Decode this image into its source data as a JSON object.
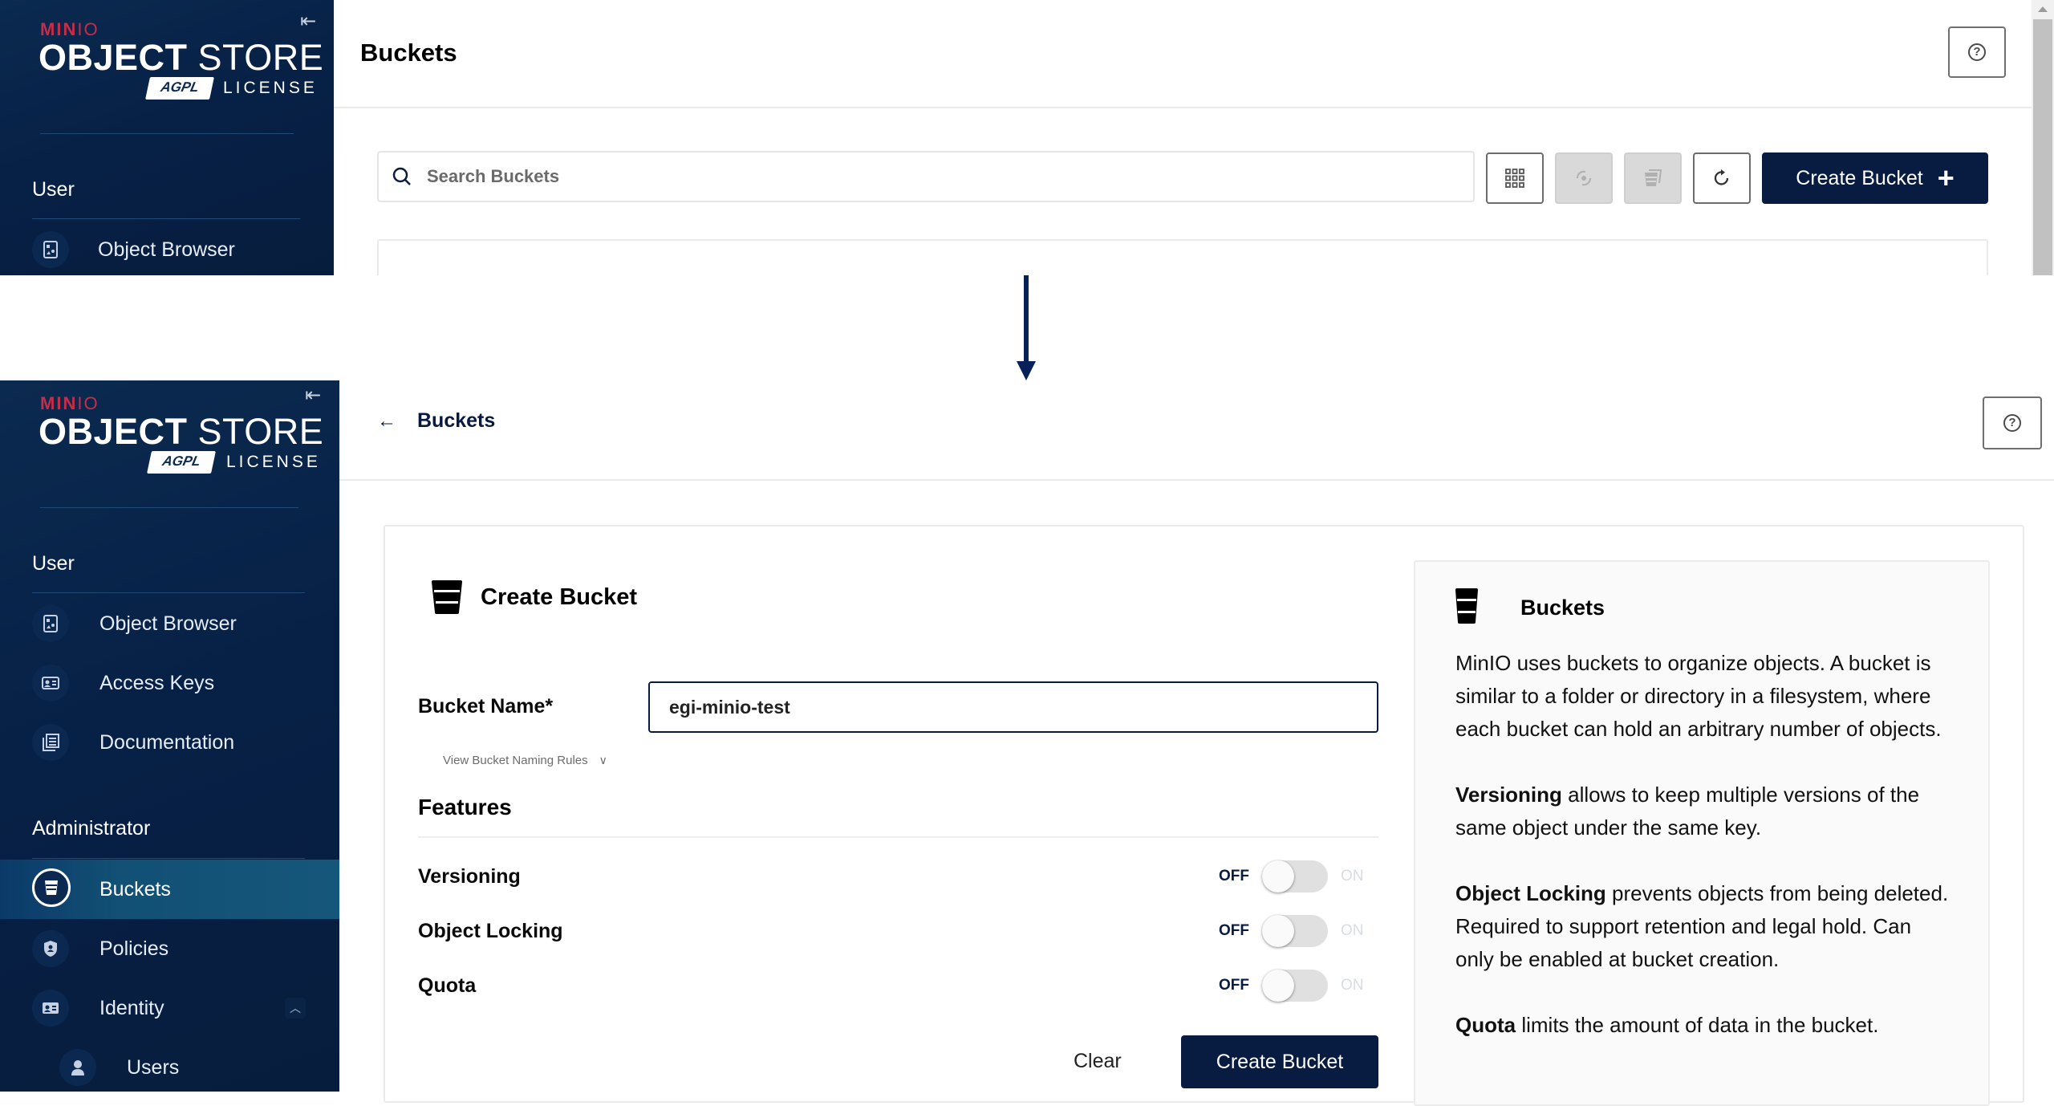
{
  "top": {
    "sidebar": {
      "brand": {
        "minio": "MIN",
        "minio_thin": "IO",
        "object": "OBJECT",
        "store": "STORE",
        "agpl": "AGPL",
        "license": "LICENSE"
      },
      "collapse_icon": "collapse-left-icon",
      "sections": [
        {
          "title": "User",
          "items": [
            {
              "label": "Object Browser",
              "icon": "object-browser-icon"
            }
          ]
        }
      ]
    },
    "header": {
      "title": "Buckets",
      "help_icon": "help-icon"
    },
    "search": {
      "placeholder": "Search Buckets",
      "value": ""
    },
    "toolbar": {
      "buttons": [
        {
          "icon": "grid-select-icon",
          "enabled": true
        },
        {
          "icon": "replicate-icon",
          "enabled": false
        },
        {
          "icon": "bulk-bucket-icon",
          "enabled": false
        },
        {
          "icon": "refresh-icon",
          "enabled": true
        }
      ],
      "create_label": "Create Bucket",
      "create_icon": "+"
    }
  },
  "bottom": {
    "sidebar": {
      "brand": {
        "minio": "MIN",
        "minio_thin": "IO",
        "object": "OBJECT",
        "store": "STORE",
        "agpl": "AGPL",
        "license": "LICENSE"
      },
      "sections": [
        {
          "title": "User",
          "items": [
            {
              "label": "Object Browser",
              "icon": "object-browser-icon"
            },
            {
              "label": "Access Keys",
              "icon": "access-keys-icon"
            },
            {
              "label": "Documentation",
              "icon": "documentation-icon"
            }
          ]
        },
        {
          "title": "Administrator",
          "items": [
            {
              "label": "Buckets",
              "icon": "bucket-icon",
              "active": true
            },
            {
              "label": "Policies",
              "icon": "policy-shield-icon"
            },
            {
              "label": "Identity",
              "icon": "identity-card-icon",
              "expanded": true
            },
            {
              "label": "Users",
              "icon": "user-icon",
              "sub": true
            }
          ]
        }
      ]
    },
    "header": {
      "back_label": "Buckets",
      "back_icon": "←"
    },
    "form": {
      "title": "Create Bucket",
      "bucket_name_label": "Bucket Name*",
      "bucket_name_value": "egi-minio-test",
      "naming_rules_label": "View Bucket Naming Rules",
      "features_title": "Features",
      "features": [
        {
          "label": "Versioning",
          "off_label": "OFF",
          "on_label": "ON",
          "enabled": false
        },
        {
          "label": "Object Locking",
          "off_label": "OFF",
          "on_label": "ON",
          "enabled": false
        },
        {
          "label": "Quota",
          "off_label": "OFF",
          "on_label": "ON",
          "enabled": false
        }
      ],
      "clear_label": "Clear",
      "submit_label": "Create Bucket"
    },
    "info": {
      "title": "Buckets",
      "intro": "MinIO uses buckets to organize objects. A bucket is similar to a folder or directory in a filesystem, where each bucket can hold an arbitrary number of objects.",
      "versioning_term": "Versioning",
      "versioning_text": " allows to keep multiple versions of the same object under the same key.",
      "locking_term": "Object Locking",
      "locking_text": " prevents objects from being deleted. Required to support retention and legal hold. Can only be enabled at bucket creation.",
      "quota_term": "Quota",
      "quota_text": " limits the amount of data in the bucket."
    }
  },
  "colors": {
    "sidebar_bg": "#071d3d",
    "primary": "#081c42",
    "brand_red": "#c72c48",
    "active_item": "#15577a",
    "arrow": "#06205a"
  }
}
